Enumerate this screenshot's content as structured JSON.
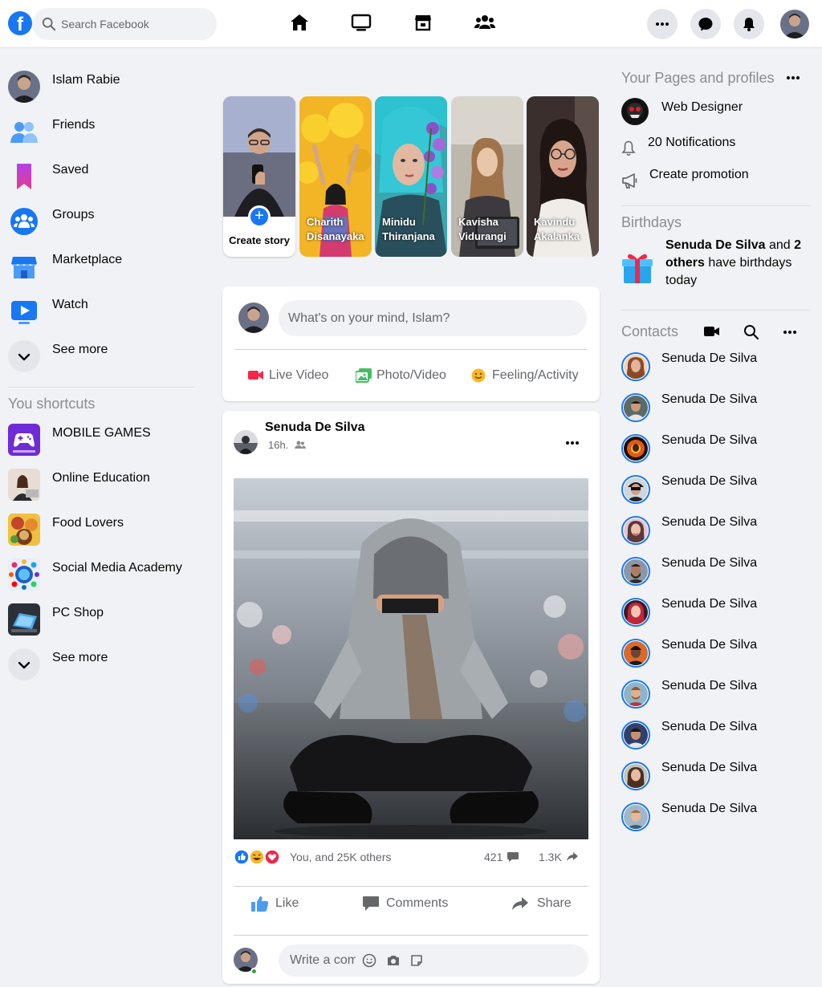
{
  "header": {
    "logo": "f",
    "search_placeholder": "Search Facebook",
    "nav_icons": [
      "home-icon",
      "watch-icon",
      "marketplace-icon",
      "groups-icon"
    ],
    "right_icons": [
      "menu-dots-icon",
      "messenger-icon",
      "notifications-bell-icon"
    ]
  },
  "left_sidebar": {
    "items": [
      {
        "label": "Islam Rabie"
      },
      {
        "label": "Friends"
      },
      {
        "label": "Saved"
      },
      {
        "label": "Groups"
      },
      {
        "label": "Marketplace"
      },
      {
        "label": "Watch"
      },
      {
        "label": "See more"
      }
    ],
    "shortcuts_title": "You shortcuts",
    "shortcuts": [
      {
        "label": "MOBILE GAMES"
      },
      {
        "label": "Online Education"
      },
      {
        "label": "Food Lovers"
      },
      {
        "label": "Social Media Academy"
      },
      {
        "label": "PC Shop"
      },
      {
        "label": "See more"
      }
    ]
  },
  "stories": {
    "create_label": "Create story",
    "items": [
      {
        "name": "Charith Disanayaka"
      },
      {
        "name": "Minidu Thiranjana"
      },
      {
        "name": "Kavisha Vidurangi"
      },
      {
        "name": "Kavindu Akalanka"
      }
    ]
  },
  "composer": {
    "placeholder": "What's on your mind, Islam?",
    "actions": [
      {
        "label": "Live Video"
      },
      {
        "label": "Photo/Video"
      },
      {
        "label": "Feeling/Activity"
      }
    ]
  },
  "post": {
    "author": "Senuda De Silva",
    "time": "16h.",
    "reactions_text": "You, and 25K others",
    "comments_count": "421",
    "shares_count": "1.3K",
    "actions": [
      {
        "label": "Like"
      },
      {
        "label": "Comments"
      },
      {
        "label": "Share"
      }
    ],
    "comment_placeholder": "Write a comment"
  },
  "right_sidebar": {
    "pages_title": "Your Pages and profiles",
    "page_name": "Web Designer",
    "notifications": "20 Notifications",
    "create_promotion": "Create promotion",
    "birthdays_title": "Birthdays",
    "birthday_name": "Senuda De Silva",
    "birthday_and": " and ",
    "birthday_others": "2 others",
    "birthday_rest": " have birthdays today",
    "contacts_title": "Contacts",
    "contacts": [
      {
        "name": "Senuda De Silva"
      },
      {
        "name": "Senuda De Silva"
      },
      {
        "name": "Senuda De Silva"
      },
      {
        "name": "Senuda De Silva"
      },
      {
        "name": "Senuda De Silva"
      },
      {
        "name": "Senuda De Silva"
      },
      {
        "name": "Senuda De Silva"
      },
      {
        "name": "Senuda De Silva"
      },
      {
        "name": "Senuda De Silva"
      },
      {
        "name": "Senuda De Silva"
      },
      {
        "name": "Senuda De Silva"
      },
      {
        "name": "Senuda De Silva"
      }
    ]
  },
  "colors": {
    "brand_blue": "#1877f2",
    "background": "#f0f2f5",
    "secondary_text": "#65676b",
    "live_red": "#f02849",
    "photo_green": "#45bd62",
    "feeling_yellow": "#f7b928"
  }
}
